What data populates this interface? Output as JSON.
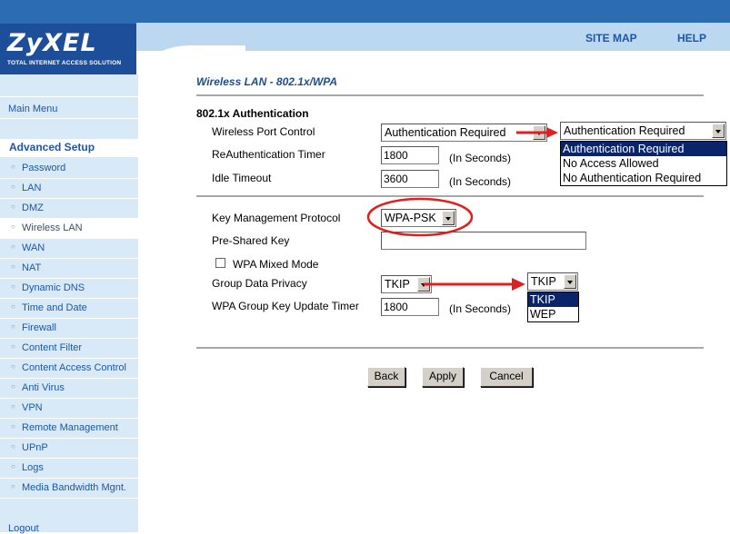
{
  "header": {
    "logo": "ZyXEL",
    "logo_tagline": "TOTAL INTERNET ACCESS SOLUTION",
    "links": [
      "SITE MAP",
      "HELP"
    ]
  },
  "sidebar": {
    "main_menu": "Main Menu",
    "section_title": "Advanced Setup",
    "items": [
      "Password",
      "LAN",
      "DMZ",
      "Wireless LAN",
      "WAN",
      "NAT",
      "Dynamic DNS",
      "Time and Date",
      "Firewall",
      "Content Filter",
      "Content Access Control",
      "Anti Virus",
      "VPN",
      "Remote Management",
      "UPnP",
      "Logs",
      "Media Bandwidth Mgnt."
    ],
    "active_item": "Wireless LAN",
    "logout": "Logout"
  },
  "page": {
    "title": "Wireless LAN - 802.1x/WPA",
    "auth_section": "802.1x Authentication",
    "port_control_label": "Wireless Port Control",
    "port_control_value": "Authentication Required",
    "port_control_options": [
      "Authentication Required",
      "No Access Allowed",
      "No Authentication Required"
    ],
    "reauth_label": "ReAuthentication Timer",
    "reauth_value": "1800",
    "idle_label": "Idle Timeout",
    "idle_value": "3600",
    "seconds_unit": "(In Seconds)",
    "kmp_label": "Key Management Protocol",
    "kmp_value": "WPA-PSK",
    "psk_label": "Pre-Shared Key",
    "psk_value": "",
    "mixed_mode_label": "WPA Mixed Mode",
    "group_privacy_label": "Group Data Privacy",
    "group_privacy_value": "TKIP",
    "group_privacy_options": [
      "TKIP",
      "WEP"
    ],
    "group_key_timer_label": "WPA Group Key Update Timer",
    "group_key_timer_value": "1800"
  },
  "buttons": {
    "back": "Back",
    "apply": "Apply",
    "cancel": "Cancel"
  },
  "colors": {
    "header_blue": "#2b6cb3",
    "logo_blue": "#1d4e9a",
    "sidebar_bg": "#d8eaf7",
    "link_blue": "#1d56a8",
    "annotation_red": "#e02020",
    "selection_navy": "#0a246a"
  }
}
